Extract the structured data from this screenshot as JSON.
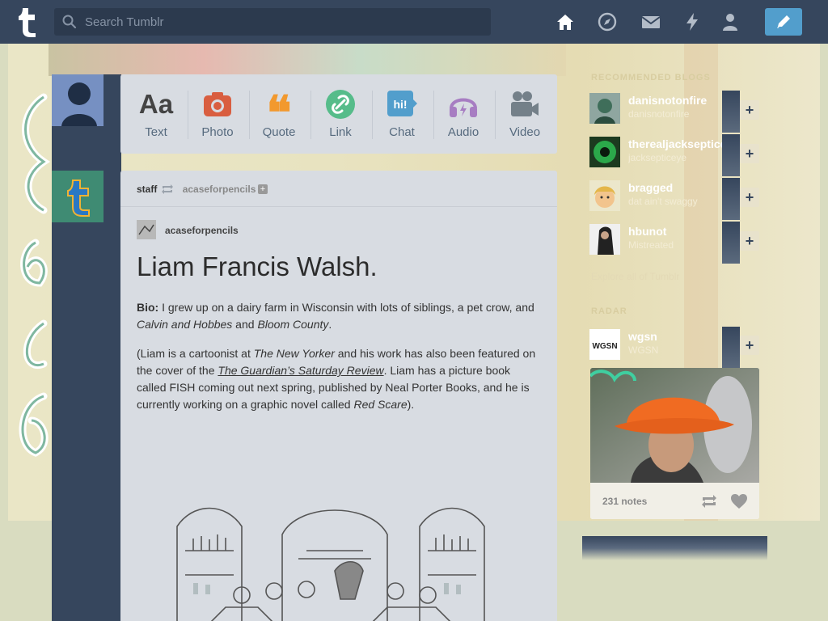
{
  "topbar": {
    "search_placeholder": "Search Tumblr"
  },
  "post_types": [
    {
      "label": "Text",
      "glyph": "Aa",
      "color": "#444444"
    },
    {
      "label": "Photo",
      "color": "#d95e40"
    },
    {
      "label": "Quote",
      "glyph": "❝",
      "color": "#f2992e"
    },
    {
      "label": "Link",
      "color": "#56bc8a"
    },
    {
      "label": "Chat",
      "glyph": "hi!",
      "color": "#529ecc"
    },
    {
      "label": "Audio",
      "color": "#a77dc2"
    },
    {
      "label": "Video",
      "color": "#748089"
    }
  ],
  "post": {
    "reblogger": "staff",
    "source": "acaseforpencils",
    "author": "acaseforpencils",
    "title": "Liam Francis Walsh.",
    "bio_label": "Bio:",
    "bio_text_1": " I grew up on a dairy farm in Wisconsin with lots of siblings, a pet crow, and ",
    "bio_italic_1": "Calvin and Hobbes",
    "bio_and": " and ",
    "bio_italic_2": "Bloom County",
    "bio_end": ".",
    "p2_open": "(Liam is a cartoonist at ",
    "p2_italic_1": "The New Yorker",
    "p2_mid_1": " and his work has also been featured on the cover of the ",
    "p2_link": "The Guardian’s Saturday Review",
    "p2_mid_2": ". Liam has a picture book called FISH coming out next spring, published by Neal Porter Books, and he is currently working on a graphic novel called ",
    "p2_italic_2": "Red Scare",
    "p2_close": ")."
  },
  "sidebar": {
    "recommended_heading": "RECOMMENDED BLOGS",
    "recommended": [
      {
        "name": "danisnotonfire",
        "sub": "danisnotonfire",
        "color": "#5b8c6e"
      },
      {
        "name": "therealjacksepticeye",
        "sub": "jacksepticeye",
        "color": "#2ba84a"
      },
      {
        "name": "bragged",
        "sub": "dat ain't swaggy",
        "color": "#d9a35b"
      },
      {
        "name": "hbunot",
        "sub": "Mistreated",
        "color": "#555555"
      }
    ],
    "explore_label": "Explore all of Tumblr",
    "radar_heading": "RADAR",
    "radar_blog": {
      "name": "wgsn",
      "sub": "WGSN",
      "logo": "WGSN"
    },
    "radar_notes": "231 notes"
  },
  "colors": {
    "navy": "#36465d",
    "accent": "#529ecc"
  }
}
